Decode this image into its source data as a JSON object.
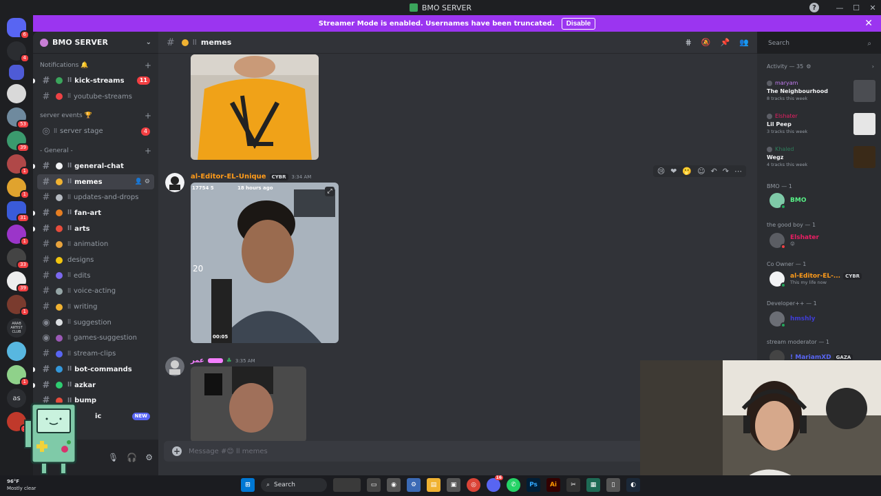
{
  "window": {
    "title": "BMO SERVER",
    "help": "?",
    "minimize": "—",
    "maximize": "☐",
    "close": "✕"
  },
  "banner": {
    "text": "Streamer Mode is enabled. Usernames have been truncated.",
    "button": "Disable",
    "close": "✕"
  },
  "rail": {
    "badges": [
      "6",
      "4",
      "53",
      "39",
      "1",
      "1",
      "31",
      "1",
      "33",
      "39",
      "1",
      "1",
      "1"
    ],
    "text_servers": [
      "ARAB ARTIST CLUB",
      "as"
    ]
  },
  "server": {
    "name": "BMO SERVER"
  },
  "categories": {
    "notifications": "Notifications 🔔",
    "server_events": "server events 🏆",
    "general": "- General -"
  },
  "channels": {
    "kick_streams": {
      "name": "kick-streams",
      "count": "11"
    },
    "youtube_streams": {
      "name": "youtube-streams"
    },
    "server_stage": {
      "name": "server stage",
      "count": "4"
    },
    "general_chat": {
      "name": "general-chat"
    },
    "memes": {
      "name": "memes"
    },
    "updates": {
      "name": "updates-and-drops"
    },
    "fan_art": {
      "name": "fan-art"
    },
    "arts": {
      "name": "arts"
    },
    "animation": {
      "name": "animation"
    },
    "designs": {
      "name": "designs"
    },
    "edits": {
      "name": "edits"
    },
    "voice_acting": {
      "name": "voice-acting"
    },
    "writing": {
      "name": "writing"
    },
    "suggestion": {
      "name": "suggestion"
    },
    "games_suggestion": {
      "name": "games-suggestion"
    },
    "stream_clips": {
      "name": "stream-clips"
    },
    "bot_commands": {
      "name": "bot-commands"
    },
    "azkar": {
      "name": "azkar"
    },
    "bump": {
      "name": "bump"
    },
    "music": {
      "name": "ic",
      "badge": "NEW"
    }
  },
  "chat": {
    "channel": "memes",
    "separator": "ll",
    "messages": [
      {
        "author": "al-Editor-EL-Unique",
        "tag": "CYBR",
        "time": "3:34 AM",
        "video_overlay_left": "17754 5",
        "video_overlay_right": "18 hours ago",
        "video_time": "00:05",
        "video_side": "20"
      },
      {
        "author": "عمر",
        "time": "3:35 AM"
      }
    ],
    "composer_placeholder": "Message #😊 ll memes"
  },
  "search": {
    "placeholder": "Search"
  },
  "members": {
    "activity_header": "Activity — 35",
    "activity": [
      {
        "user": "maryam",
        "title": "The Neighbourhood",
        "sub": "8 tracks this week",
        "color": "#c27cf0"
      },
      {
        "user": "Elshater",
        "title": "Lil Peep",
        "sub": "3 tracks this week",
        "color": "#e91e63"
      },
      {
        "user": "Khaled",
        "title": "Wegz",
        "sub": "4 tracks this week",
        "color": "#2e7d5b"
      }
    ],
    "roles": [
      {
        "header": "BMO — 1",
        "name": "BMO",
        "color": "#57f287"
      },
      {
        "header": "the good boy — 1",
        "name": "Elshater",
        "color": "#e91e63",
        "sub": "😝"
      },
      {
        "header": "Co Owner — 1",
        "name": "al-Editor-EL-...",
        "color": "#ff9b1a",
        "tag": "CYBR",
        "sub": "This my life now"
      },
      {
        "header": "Developer++ — 1",
        "name": "hmshly",
        "color": "#3f3dd6"
      },
      {
        "header": "stream moderator — 1",
        "name": "! MariamXD",
        "color": "#5865f2",
        "tag": "GAZA"
      }
    ]
  },
  "taskbar": {
    "temp": "96°F",
    "weather": "Mostly clear",
    "search": "Search",
    "discord_badge": "16"
  }
}
